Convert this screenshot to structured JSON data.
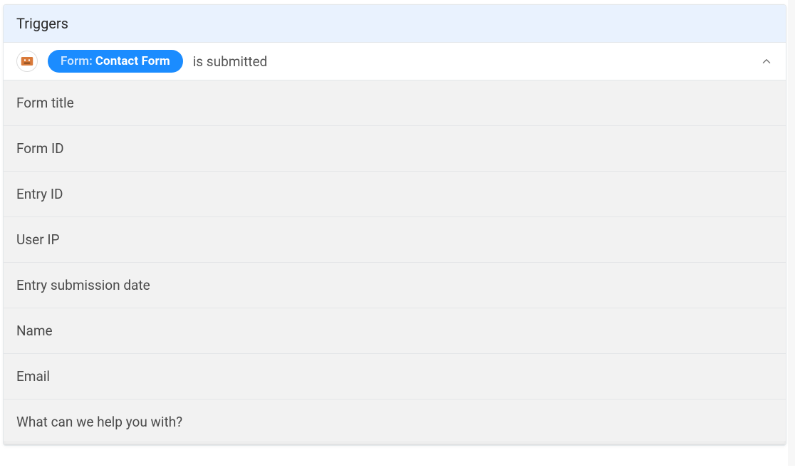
{
  "header": {
    "title": "Triggers"
  },
  "trigger": {
    "pill_prefix": "Form:",
    "pill_name": "Contact Form",
    "suffix": "is submitted"
  },
  "fields": [
    "Form title",
    "Form ID",
    "Entry ID",
    "User IP",
    "Entry submission date",
    "Name",
    "Email",
    "What can we help you with?"
  ]
}
